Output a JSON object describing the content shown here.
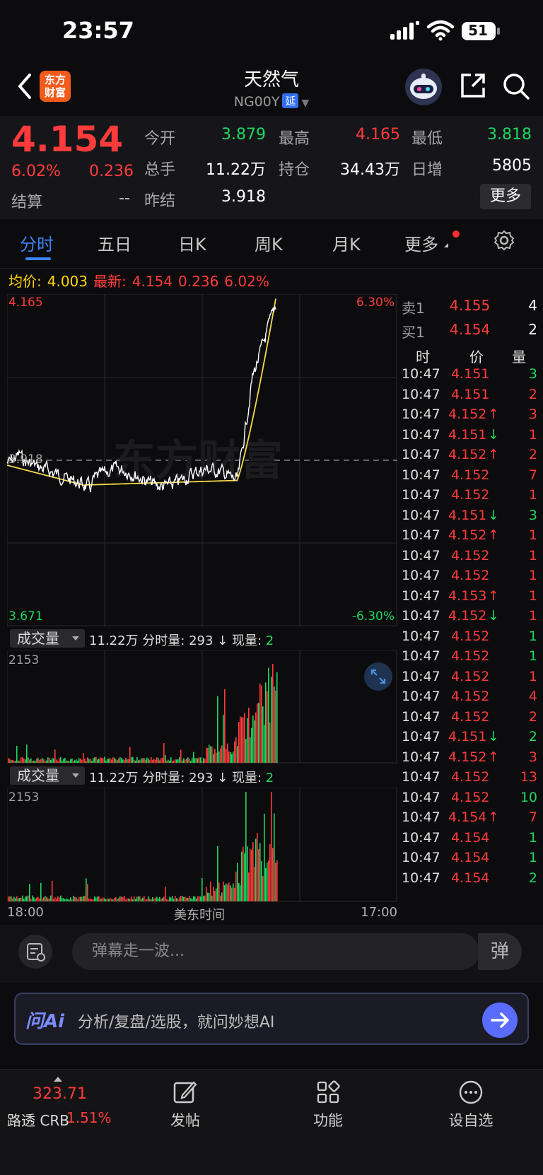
{
  "status": {
    "time": "23:57",
    "battery": "51"
  },
  "header": {
    "logo": "东方财富",
    "title": "天然气",
    "subtitle": "NG00Y",
    "delay_badge": "延"
  },
  "quote": {
    "price": "4.154",
    "pct": "6.02%",
    "chg": "0.236",
    "settle_label": "结算",
    "settle_val": "--",
    "open_label": "今开",
    "open_val": "3.879",
    "high_label": "最高",
    "high_val": "4.165",
    "low_label": "最低",
    "low_val": "3.818",
    "vol_label": "总手",
    "vol_val": "11.22万",
    "oi_label": "持仓",
    "oi_val": "34.43万",
    "inc_label": "日增",
    "inc_val": "5805",
    "prev_label": "昨结",
    "prev_val": "3.918",
    "more_btn": "更多"
  },
  "tabs": [
    "分时",
    "五日",
    "日K",
    "周K",
    "月K",
    "更多"
  ],
  "avg": {
    "avg_label": "均价:",
    "avg_val": "4.003",
    "last_label": "最新:",
    "last_val": "4.154",
    "chg": "0.236",
    "pct": "6.02%"
  },
  "chart": {
    "top_price": "4.165",
    "top_pct": "6.30%",
    "mid_price": "3.918",
    "bot_price": "3.671",
    "bot_pct": "-6.30%",
    "watermark": "东方财富",
    "time_start": "18:00",
    "time_mid": "美东时间",
    "time_end": "17:00"
  },
  "volume": {
    "btn": "成交量",
    "total": "11.22万",
    "min_label": "分时量:",
    "min_val": "293 ↓",
    "now_label": "现量:",
    "now_val": "2",
    "max": "2153"
  },
  "orderbook": {
    "ask": {
      "label": "卖1",
      "price": "4.155",
      "qty": "4"
    },
    "bid": {
      "label": "买1",
      "price": "4.154",
      "qty": "2"
    },
    "head": {
      "time": "时",
      "price": "价",
      "qty": "量"
    }
  },
  "trades": [
    {
      "t": "10:47",
      "p": "4.151",
      "a": "",
      "q": "3",
      "c": "green"
    },
    {
      "t": "10:47",
      "p": "4.151",
      "a": "",
      "q": "2",
      "c": "red"
    },
    {
      "t": "10:47",
      "p": "4.152",
      "a": "↑",
      "q": "3",
      "c": "red"
    },
    {
      "t": "10:47",
      "p": "4.151",
      "a": "↓",
      "q": "1",
      "c": "red"
    },
    {
      "t": "10:47",
      "p": "4.152",
      "a": "↑",
      "q": "2",
      "c": "red"
    },
    {
      "t": "10:47",
      "p": "4.152",
      "a": "",
      "q": "7",
      "c": "red"
    },
    {
      "t": "10:47",
      "p": "4.152",
      "a": "",
      "q": "1",
      "c": "red"
    },
    {
      "t": "10:47",
      "p": "4.151",
      "a": "↓",
      "q": "3",
      "c": "green"
    },
    {
      "t": "10:47",
      "p": "4.152",
      "a": "↑",
      "q": "1",
      "c": "red"
    },
    {
      "t": "10:47",
      "p": "4.152",
      "a": "",
      "q": "1",
      "c": "red"
    },
    {
      "t": "10:47",
      "p": "4.152",
      "a": "",
      "q": "1",
      "c": "red"
    },
    {
      "t": "10:47",
      "p": "4.153",
      "a": "↑",
      "q": "1",
      "c": "red"
    },
    {
      "t": "10:47",
      "p": "4.152",
      "a": "↓",
      "q": "1",
      "c": "red"
    },
    {
      "t": "10:47",
      "p": "4.152",
      "a": "",
      "q": "1",
      "c": "green"
    },
    {
      "t": "10:47",
      "p": "4.152",
      "a": "",
      "q": "1",
      "c": "green"
    },
    {
      "t": "10:47",
      "p": "4.152",
      "a": "",
      "q": "1",
      "c": "red"
    },
    {
      "t": "10:47",
      "p": "4.152",
      "a": "",
      "q": "4",
      "c": "red"
    },
    {
      "t": "10:47",
      "p": "4.152",
      "a": "",
      "q": "2",
      "c": "red"
    },
    {
      "t": "10:47",
      "p": "4.151",
      "a": "↓",
      "q": "2",
      "c": "green"
    },
    {
      "t": "10:47",
      "p": "4.152",
      "a": "↑",
      "q": "3",
      "c": "red"
    },
    {
      "t": "10:47",
      "p": "4.152",
      "a": "",
      "q": "13",
      "c": "red"
    },
    {
      "t": "10:47",
      "p": "4.152",
      "a": "",
      "q": "10",
      "c": "green"
    },
    {
      "t": "10:47",
      "p": "4.154",
      "a": "↑",
      "q": "7",
      "c": "red"
    },
    {
      "t": "10:47",
      "p": "4.154",
      "a": "",
      "q": "1",
      "c": "green"
    },
    {
      "t": "10:47",
      "p": "4.154",
      "a": "",
      "q": "1",
      "c": "green"
    },
    {
      "t": "10:47",
      "p": "4.154",
      "a": "",
      "q": "2",
      "c": "green"
    }
  ],
  "danmu": {
    "placeholder": "弹幕走一波...",
    "switch": "弹"
  },
  "ai": {
    "logo": "问Ai",
    "text": "分析/复盘/选股，就问妙想AI"
  },
  "bottom": {
    "ticker_val": "323.71",
    "ticker_name": "路透 CRB",
    "ticker_pct": "1.51%",
    "post": "发帖",
    "func": "功能",
    "watch": "设自选"
  }
}
